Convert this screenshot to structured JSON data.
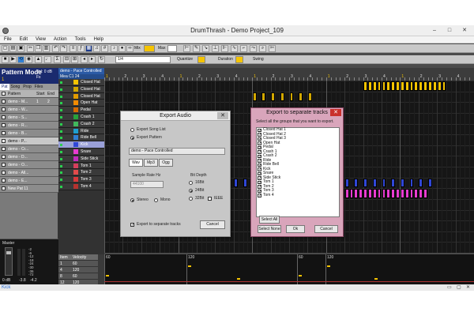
{
  "window": {
    "title": "DrumThrash - Demo Project_109"
  },
  "menu": [
    "File",
    "Edit",
    "View",
    "Action",
    "Tools",
    "Help"
  ],
  "toolbar1": {
    "mix_label": "Mix",
    "max_label": "Max"
  },
  "toolbar2": {
    "quant_value": "1/4",
    "quantize_label": "Quantize",
    "duration_label": "Duration",
    "swing_label": "Swing"
  },
  "left": {
    "mode_title": "Pattern Mode",
    "vol": "Vol: 0 dB",
    "fx": "Fx",
    "pattern_number": "1",
    "tabs": [
      "Pat",
      "Song",
      "Prop",
      "Files"
    ],
    "table_headers": [
      "Pattern",
      "Start",
      "End"
    ],
    "patterns": [
      {
        "name": "demo - M...",
        "start": "1",
        "end": "2"
      },
      {
        "name": "demo - W...",
        "start": "",
        "end": ""
      },
      {
        "name": "demo - S...",
        "start": "",
        "end": ""
      },
      {
        "name": "demo - R...",
        "start": "",
        "end": ""
      },
      {
        "name": "demo - B...",
        "start": "",
        "end": ""
      },
      {
        "name": "demo - P...",
        "start": "",
        "end": ""
      },
      {
        "name": "demo - Cr...",
        "start": "",
        "end": ""
      },
      {
        "name": "demo - D...",
        "start": "",
        "end": ""
      },
      {
        "name": "demo - O...",
        "start": "",
        "end": ""
      },
      {
        "name": "demo - All...",
        "start": "",
        "end": ""
      },
      {
        "name": "demo - E...",
        "start": "",
        "end": ""
      },
      {
        "name": "New Pat 11",
        "start": "",
        "end": ""
      }
    ],
    "master_label": "Master",
    "db_readout": [
      "0 dB",
      "-3.8",
      "-4.2"
    ],
    "meter_scale": [
      "-2",
      "-6",
      "-12",
      "-18",
      "-24",
      "-30",
      "-36",
      "-72"
    ]
  },
  "track_header": "demo - Pace Controlled",
  "track_subheader": "Mea C1  24",
  "tracks": [
    {
      "name": "Closed Hat",
      "color": "#f5c400"
    },
    {
      "name": "Closed Hat",
      "color": "#d2a700"
    },
    {
      "name": "Closed Hat",
      "color": "#e19b00"
    },
    {
      "name": "Open Hat",
      "color": "#f28b00"
    },
    {
      "name": "Pedal",
      "color": "#d56a00"
    },
    {
      "name": "Crash 1",
      "color": "#27a33b"
    },
    {
      "name": "Crash 2",
      "color": "#41b85c"
    },
    {
      "name": "Ride",
      "color": "#1ea0d0"
    },
    {
      "name": "Ride Bell",
      "color": "#2f7fd4"
    },
    {
      "name": "Kick",
      "color": "#3047d6"
    },
    {
      "name": "Snare",
      "color": "#e83cd0"
    },
    {
      "name": "Side Stick",
      "color": "#c22bbd"
    },
    {
      "name": "Tom 1",
      "color": "#d53f5c"
    },
    {
      "name": "Tom 2",
      "color": "#e14b4b"
    },
    {
      "name": "Tom 3",
      "color": "#d6393b"
    },
    {
      "name": "Tom 4",
      "color": "#b5322f"
    }
  ],
  "ruler_marks": [
    "1",
    "2",
    "3",
    "4",
    "1",
    "2",
    "3",
    "4",
    "1",
    "2",
    "3",
    "4",
    "1",
    "2",
    "3",
    "4",
    "1",
    "2",
    "3",
    "4"
  ],
  "bottom": {
    "table_headers": [
      "Item",
      "Velocity"
    ],
    "rows": [
      [
        "1",
        "60"
      ],
      [
        "4",
        "120"
      ],
      [
        "8",
        "60"
      ],
      [
        "12",
        "120"
      ],
      [
        "16",
        "60"
      ]
    ],
    "markers": [
      "60",
      "120",
      "60",
      "120"
    ]
  },
  "export_audio": {
    "title": "Export Audio",
    "export_song_list": "Export Song List",
    "export_pattern": "Export Pattern",
    "pattern_select": "demo - Pace Controlled",
    "format_tabs": [
      "Wav",
      "Mp3",
      "Ogg"
    ],
    "sample_rate_label": "Sample Rate Hz",
    "sample_rate_value": "44100",
    "bit_depth_label": "Bit Depth",
    "bit_options": [
      "16Bit",
      "24Bit",
      "32Bit"
    ],
    "ieee_label": "IEEE",
    "stereo": "Stereo",
    "mono": "Mono",
    "separate_tracks": "Export to separate tracks",
    "cancel": "Cancel"
  },
  "export_separate": {
    "title": "Export to separate tracks",
    "instruction": "Select all the groups that you want to export.",
    "items": [
      "Closed Hat 1",
      "Closed Hat 2",
      "Closed Hat 3",
      "Open Hat",
      "Pedal",
      "Crash 1",
      "Crash 2",
      "Ride",
      "Ride Bell",
      "Kick",
      "Snare",
      "Side Stick",
      "Tom 1",
      "Tom 2",
      "Tom 3",
      "Tom 4"
    ],
    "select_all": "Select All",
    "select_none": "Select None",
    "ok": "Ok",
    "cancel": "Cancel"
  },
  "status": {
    "instrument": "Kick"
  },
  "colors": {
    "accent_blue": "#1a2a6e",
    "dialog_pink": "#d9a5bb",
    "note_yellow": "#f5c400",
    "note_blue": "#3047d6"
  }
}
